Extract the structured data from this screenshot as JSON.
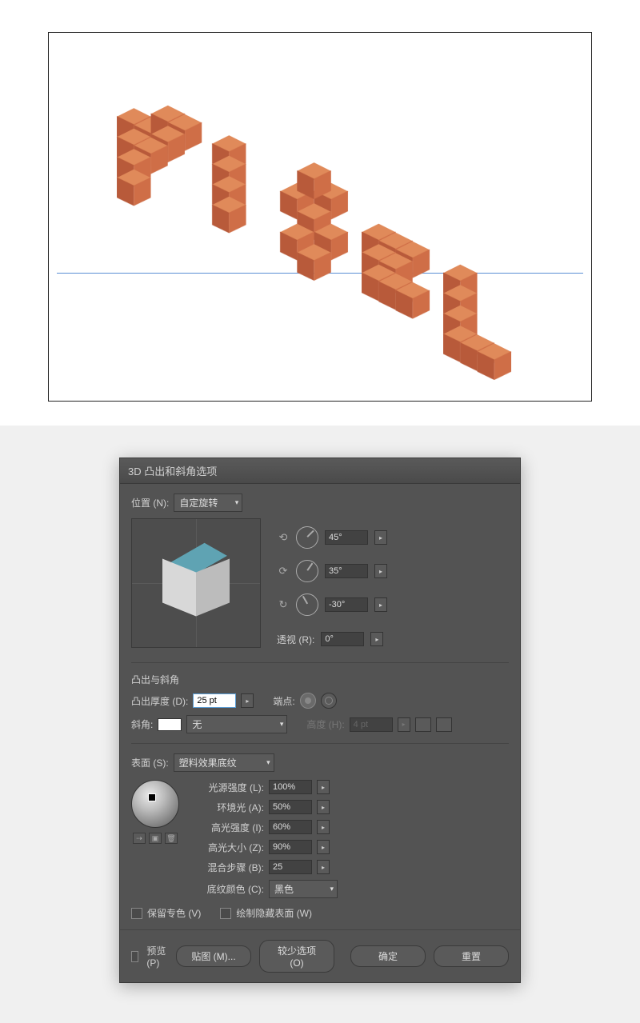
{
  "canvas": {
    "word": "PIXEL"
  },
  "dialog": {
    "title": "3D 凸出和斜角选项",
    "position_label": "位置 (N):",
    "position_value": "自定旋转",
    "rotation": {
      "x": "45°",
      "y": "35°",
      "z": "-30°"
    },
    "perspective_label": "透视 (R):",
    "perspective_value": "0°",
    "extrude_section": "凸出与斜角",
    "extrude_depth_label": "凸出厚度 (D):",
    "extrude_depth_value": "25 pt",
    "cap_label": "端点:",
    "bevel_label": "斜角:",
    "bevel_value": "无",
    "height_label": "高度 (H):",
    "height_value": "4 pt",
    "surface_label": "表面 (S):",
    "surface_value": "塑料效果底纹",
    "light_intensity_label": "光源强度 (L):",
    "light_intensity_value": "100%",
    "ambient_label": "环境光 (A):",
    "ambient_value": "50%",
    "highlight_intensity_label": "高光强度 (I):",
    "highlight_intensity_value": "60%",
    "highlight_size_label": "高光大小 (Z):",
    "highlight_size_value": "90%",
    "blend_steps_label": "混合步骤 (B):",
    "blend_steps_value": "25",
    "shading_color_label": "底纹颜色 (C):",
    "shading_color_value": "黑色",
    "preserve_spot_label": "保留专色 (V)",
    "draw_hidden_label": "绘制隐藏表面 (W)",
    "preview_label": "预览 (P)",
    "map_art_btn": "贴图 (M)...",
    "fewer_options_btn": "较少选项 (O)",
    "ok_btn": "确定",
    "reset_btn": "重置"
  }
}
